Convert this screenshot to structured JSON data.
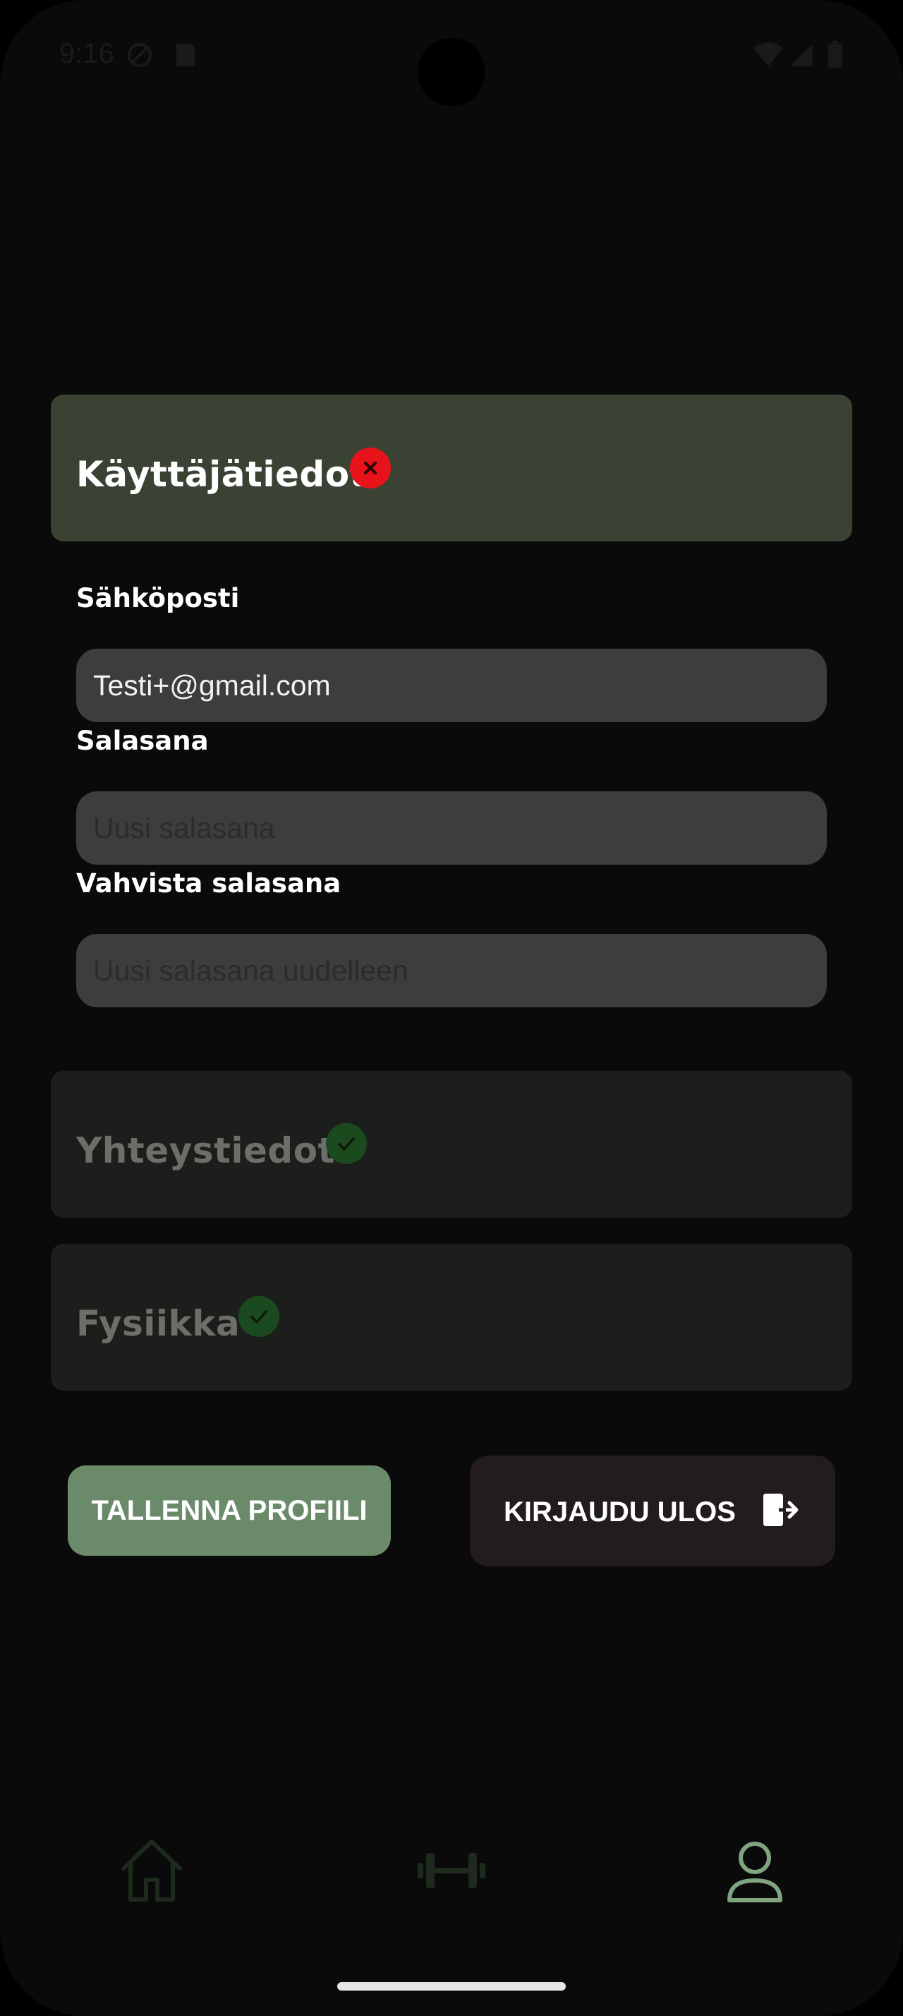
{
  "status_bar": {
    "time": "9:16"
  },
  "sections": {
    "user_info": {
      "title": "Käyttäjätiedot",
      "status": "invalid",
      "status_icon": "close-icon"
    },
    "contact_info": {
      "title": "Yhteystiedot",
      "status": "valid",
      "status_icon": "check-icon"
    },
    "physique": {
      "title": "Fysiikka",
      "status": "valid",
      "status_icon": "check-icon"
    }
  },
  "form": {
    "email": {
      "label": "Sähköposti",
      "value": "Testi+@gmail.com"
    },
    "password": {
      "label": "Salasana",
      "placeholder": "Uusi salasana",
      "value": ""
    },
    "confirm_password": {
      "label": "Vahvista salasana",
      "placeholder": "Uusi salasana uudelleen",
      "value": ""
    }
  },
  "actions": {
    "save_label": "TALLENNA PROFIILI",
    "logout_label": "KIRJAUDU ULOS",
    "logout_icon": "logout-icon"
  },
  "bottom_nav": {
    "items": [
      {
        "name": "home",
        "icon": "home-icon",
        "active": false
      },
      {
        "name": "workouts",
        "icon": "dumbbell-icon",
        "active": false
      },
      {
        "name": "profile",
        "icon": "user-icon",
        "active": true
      }
    ]
  },
  "colors": {
    "background": "#0a0a0a",
    "active_section": "#3a4234",
    "inactive_section": "#1b1e1a",
    "error": "#e8121a",
    "success": "#1c4a1f",
    "accent_green": "#6a8a6a",
    "logout_bg": "#221c1c"
  }
}
